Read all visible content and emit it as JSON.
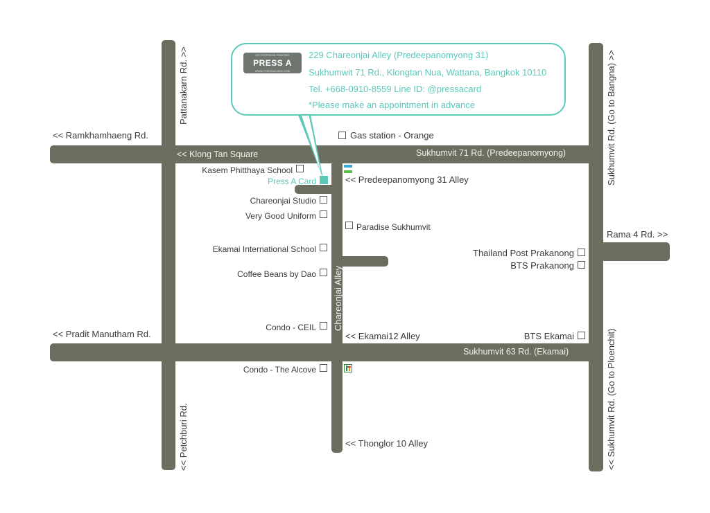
{
  "callout": {
    "logo_text": "PRESS A CARD",
    "logo_top": "LETTERPRESS PRINTING",
    "logo_bottom": "WWW.PRESSACARD.COM",
    "address_line1": "229 Chareonjai Alley (Predeepanomyong 31)",
    "address_line2": "Sukhumwit 71 Rd., Klongtan Nua, Wattana, Bangkok 10110",
    "contact": "Tel. +668-0910-8559  Line ID: @pressacard",
    "note": "*Please make an appointment in advance"
  },
  "roads": {
    "pattanakarn": "Pattanakarn Rd. >>",
    "petchburi": "<< Petchburi Rd.",
    "sukhumvit_bangna": "Sukhumvit Rd. (Go to Bangna) >>",
    "sukhumvit_ploenchit": "<< Sukhumvit Rd. (Go to Ploenchit)",
    "ramkhamhaeng": "<< Ramkhamhaeng Rd.",
    "klong_tan": "<< Klong Tan Square",
    "sukhumvit71": "Sukhumvit 71 Rd. (Predeepanomyong)",
    "pradit": "<< Pradit Manutham Rd.",
    "sukhumvit63": "Sukhumvit 63 Rd. (Ekamai)",
    "rama4": "Rama 4 Rd. >>",
    "chareonjai": "Chareonjai Alley",
    "predeepanomyong31": "<< Predeepanomyong 31 Alley",
    "ekamai12": "<< Ekamai12 Alley",
    "thonglor10": "<< Thonglor 10 Alley"
  },
  "places": {
    "gas_station": "Gas station - Orange",
    "kasem": "Kasem Phitthaya School",
    "press_a_card": "Press A Card",
    "chareonjai_studio": "Chareonjai Studio",
    "very_good_uniform": "Very Good Uniform",
    "paradise": "Paradise Sukhumvit",
    "ekamai_international": "Ekamai International School",
    "coffee_beans": "Coffee Beans by Dao",
    "condo_ceil": "Condo - CEIL",
    "condo_alcove": "Condo - The Alcove",
    "thailand_post": "Thailand Post Prakanong",
    "bts_prakanong": "BTS Prakanong",
    "bts_ekamai": "BTS Ekamai"
  },
  "colors": {
    "road": "#6b6d5f",
    "accent": "#5cc9b8"
  }
}
